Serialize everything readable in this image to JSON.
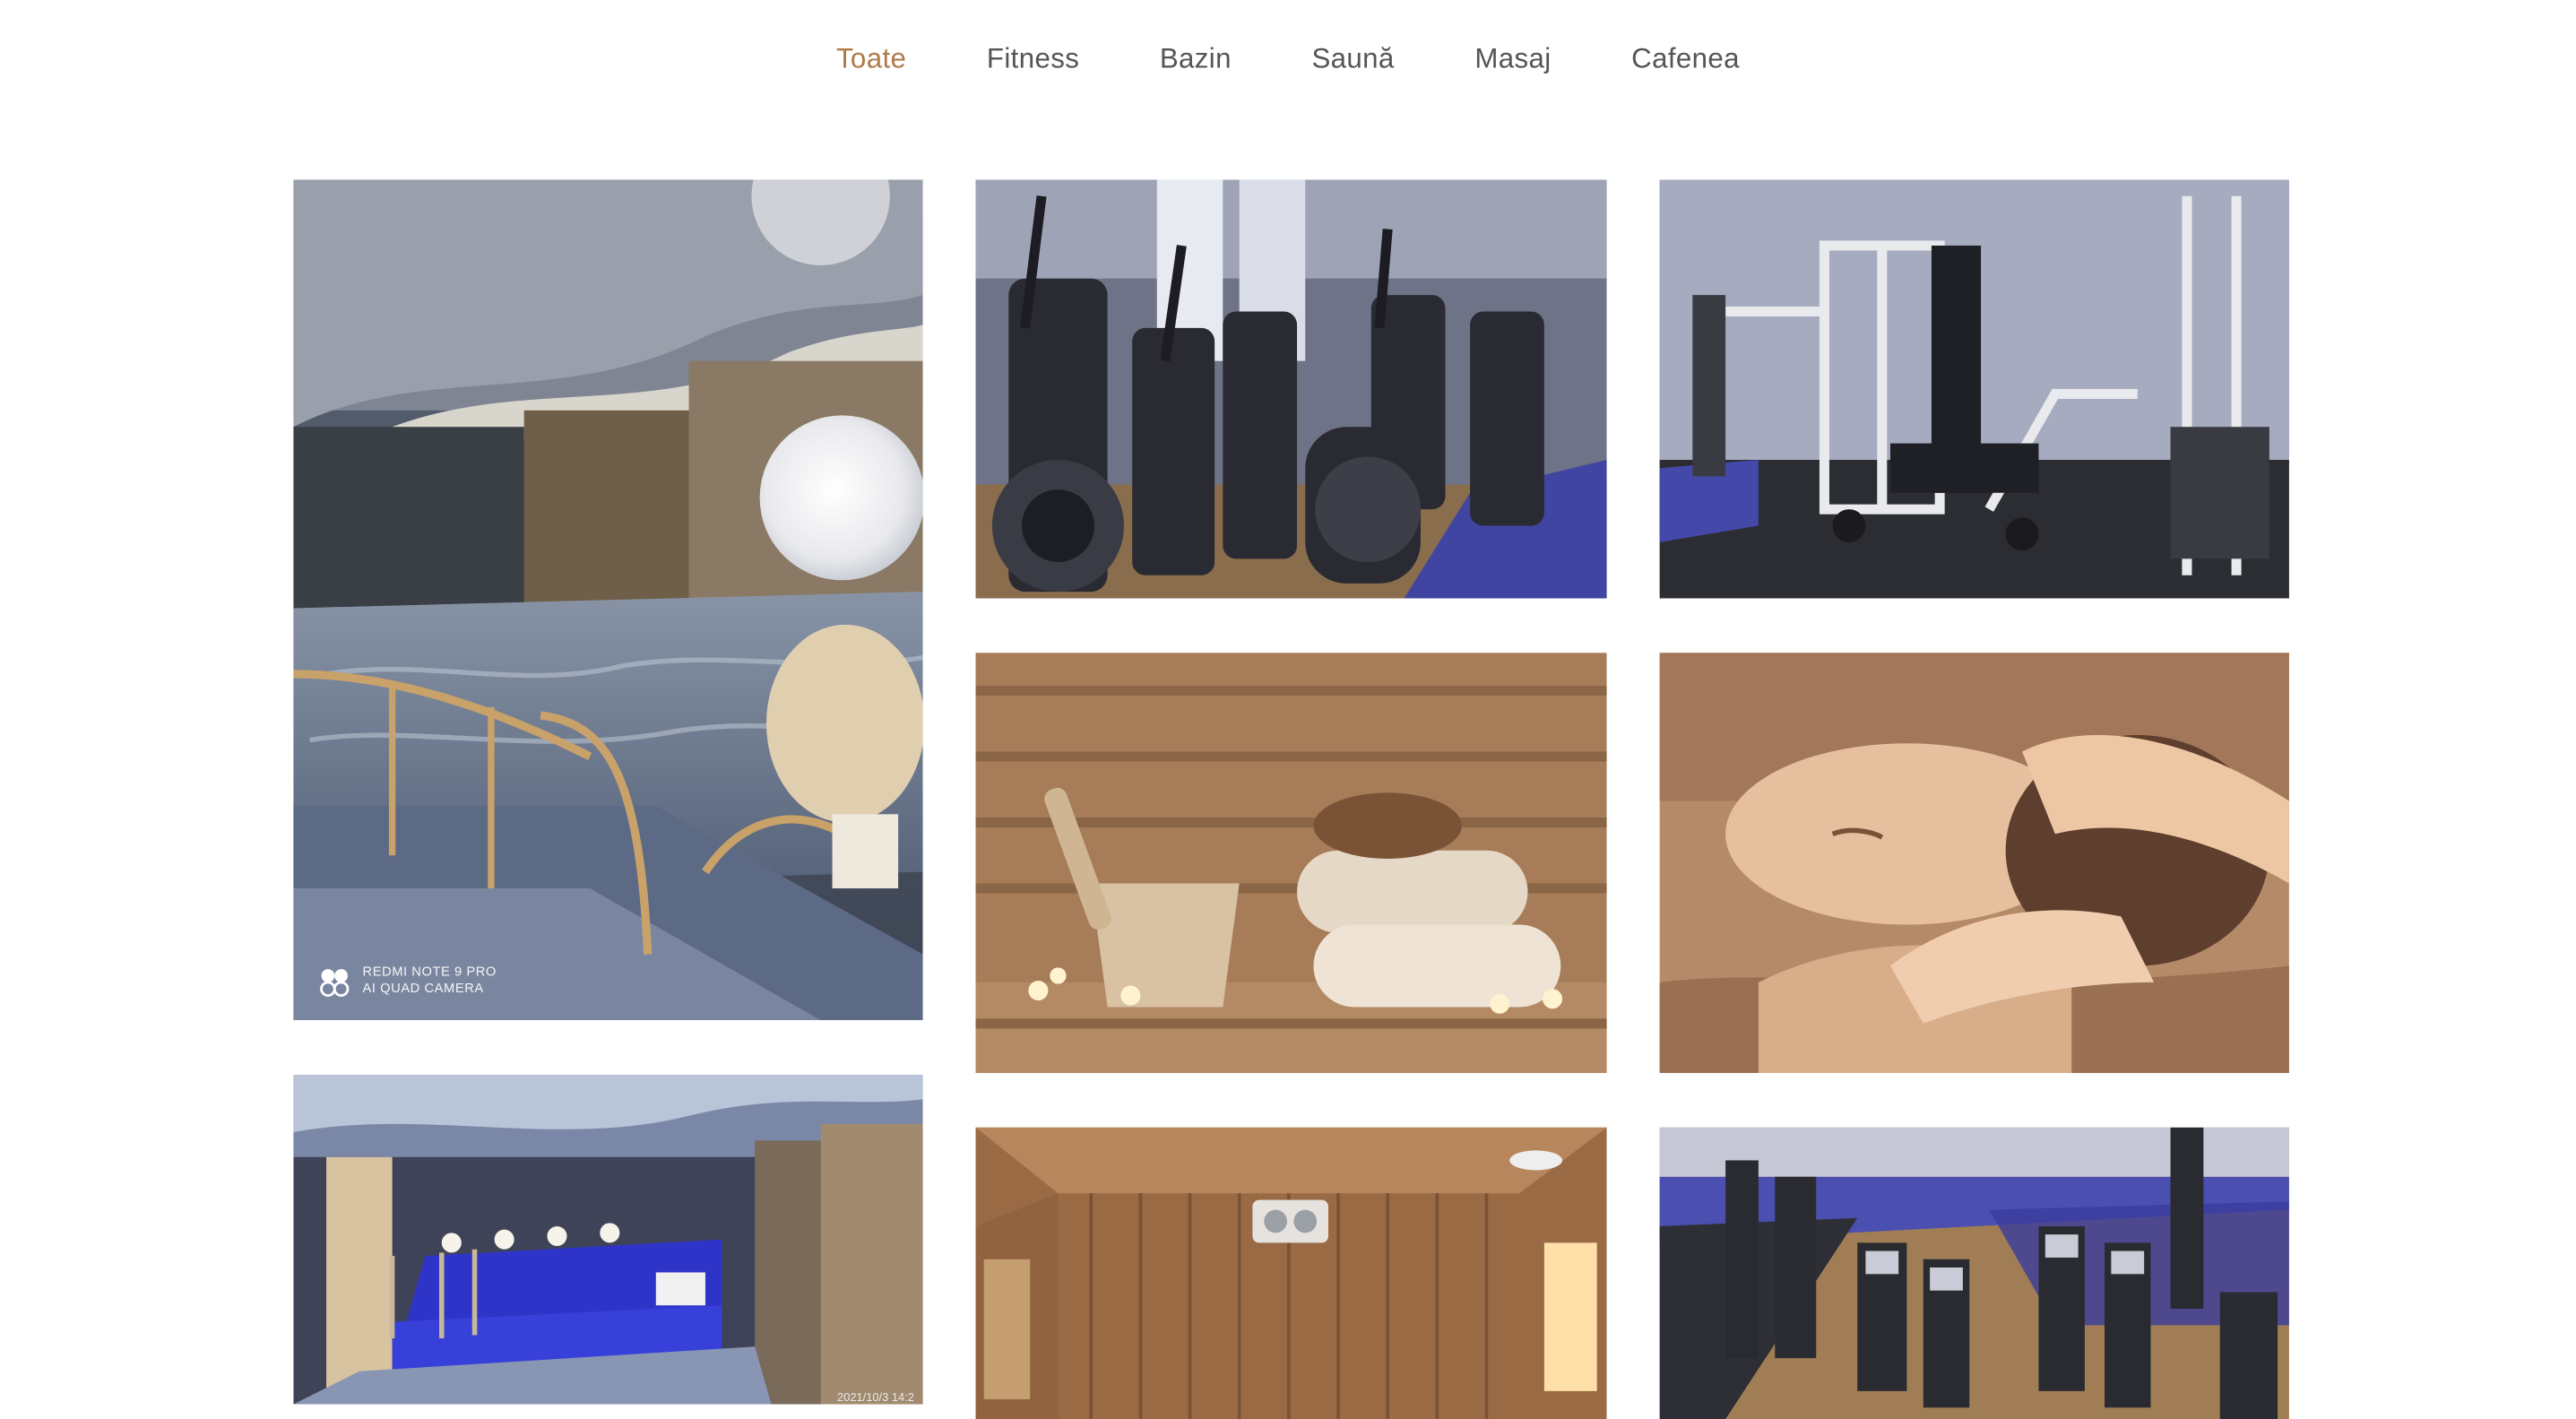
{
  "filters": [
    "Toate",
    "Fitness",
    "Bazin",
    "Saună",
    "Masaj",
    "Cafenea"
  ],
  "active_filter": "Toate",
  "colors": {
    "active": "#b07a47",
    "inactive": "#555555",
    "background": "#ffffff"
  },
  "gallery": {
    "items": [
      {
        "category": "Bazin",
        "image": "jacuzzi-moon-pool"
      },
      {
        "category": "Fitness",
        "image": "gym-ellipticals"
      },
      {
        "category": "Fitness",
        "image": "gym-smith-machine"
      },
      {
        "category": "Saună",
        "image": "sauna-bucket-towels"
      },
      {
        "category": "Masaj",
        "image": "face-massage"
      },
      {
        "category": "Bazin",
        "image": "indoor-pool"
      },
      {
        "category": "Saună",
        "image": "wooden-sauna-room"
      },
      {
        "category": "Fitness",
        "image": "gym-overview"
      }
    ],
    "watermark_line1": "REDMI NOTE 9 PRO",
    "watermark_line2": "AI QUAD CAMERA",
    "pool_timestamp": "2021/10/3 14:2"
  }
}
